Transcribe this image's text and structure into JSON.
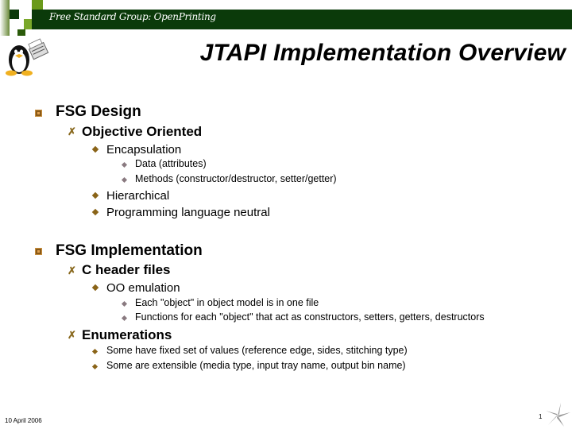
{
  "header": {
    "organization": "Free Standard Group: OpenPrinting",
    "logo": "tux-penguin-printer-icon",
    "colors": {
      "band": "#0b3a0a",
      "accent": "#8a6418"
    }
  },
  "slide": {
    "title": "JTAPI Implementation Overview",
    "sections": [
      {
        "label": "FSG Design",
        "items": [
          {
            "label": "Objective Oriented",
            "children": [
              {
                "label": "Encapsulation",
                "children": [
                  "Data (attributes)",
                  "Methods (constructor/destructor, setter/getter)"
                ]
              },
              {
                "label": "Hierarchical"
              },
              {
                "label": "Programming language neutral"
              }
            ]
          }
        ]
      },
      {
        "label": "FSG Implementation",
        "items": [
          {
            "label": "C header files",
            "children": [
              {
                "label": "OO emulation",
                "children": [
                  "Each \"object\" in object model is in one file",
                  "Functions  for each \"object\" that act as constructors, setters, getters, destructors"
                ]
              }
            ]
          },
          {
            "label": "Enumerations",
            "children": [
              {
                "label": "Some have fixed set of values (reference edge, sides, stitching type)"
              },
              {
                "label": "Some are extensible (media type, input tray name, output bin name)"
              }
            ]
          }
        ]
      }
    ]
  },
  "footer": {
    "date": "10 April 2006",
    "page_number": "1",
    "logo": "pinwheel-star-icon"
  }
}
